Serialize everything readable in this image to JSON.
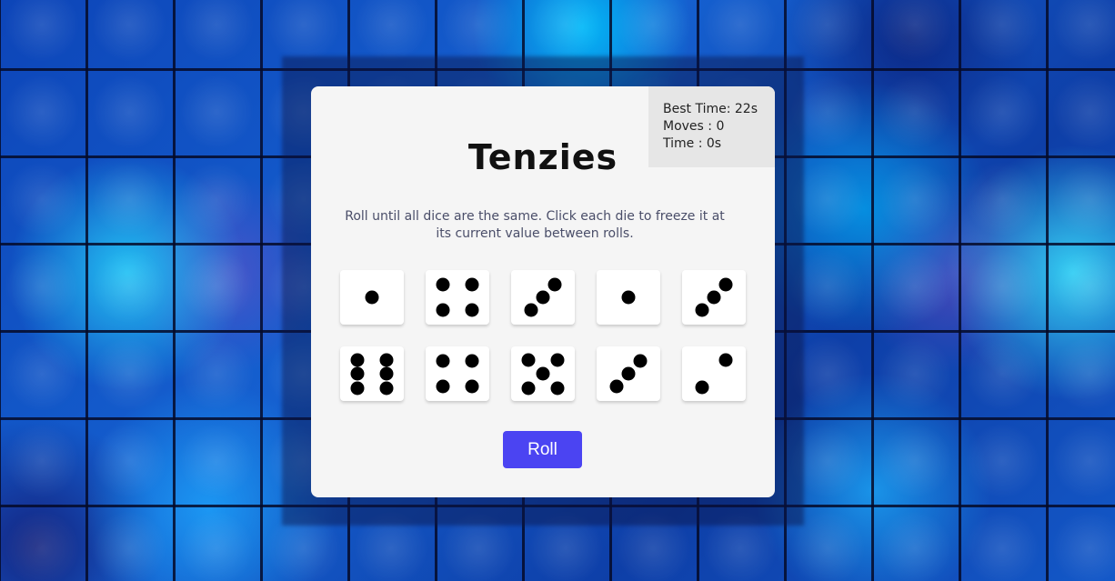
{
  "stats": {
    "best_time": "Best Time: 22s",
    "moves": "Moves : 0",
    "time": "Time : 0s"
  },
  "title": "Tenzies",
  "instructions": "Roll until all dice are the same. Click each die to freeze it at its current value between rolls.",
  "dice": [
    1,
    4,
    3,
    1,
    3,
    6,
    4,
    5,
    3,
    2
  ],
  "roll_button": "Roll",
  "colors": {
    "card_background": "#f5f5f5",
    "stats_background": "#e6e6e6",
    "button": "#4b44f2",
    "instructions_text": "#4a4e69",
    "die_face": "#ffffff",
    "pip": "#000000"
  }
}
